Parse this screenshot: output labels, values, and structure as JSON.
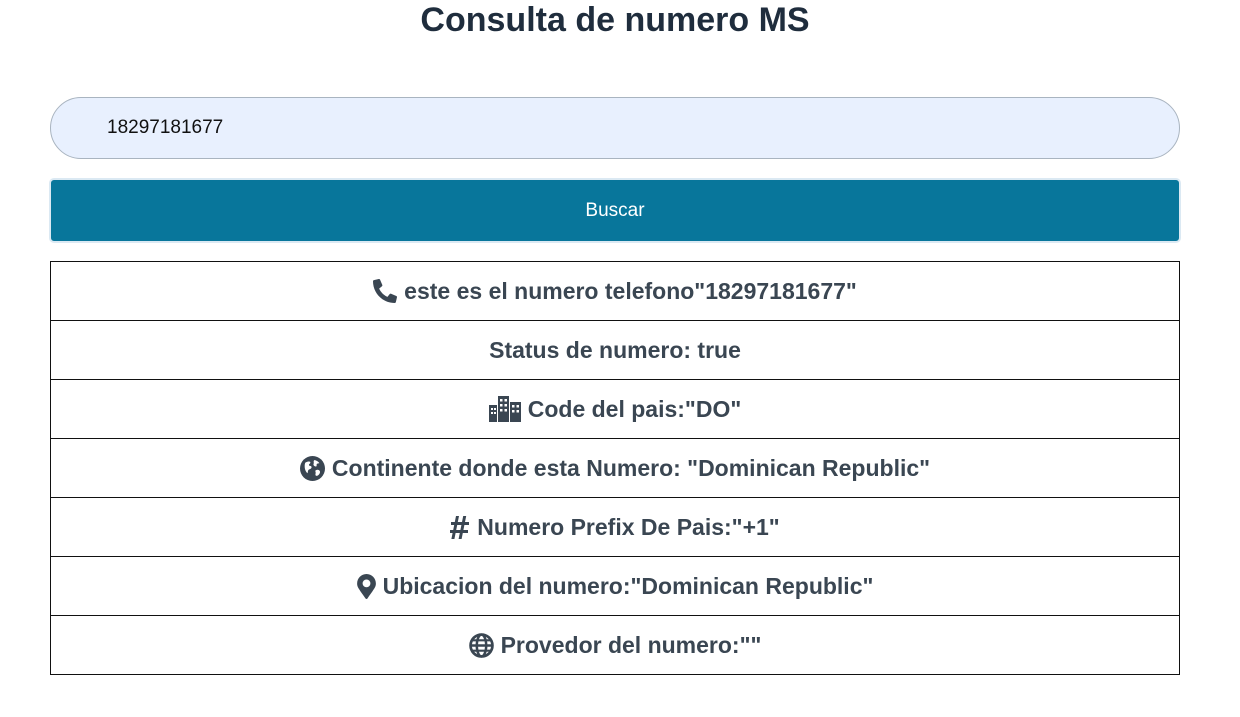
{
  "page": {
    "title": "Consulta de numero MS"
  },
  "search": {
    "value": "18297181677",
    "button_label": "Buscar"
  },
  "results": [
    {
      "icon": "phone-icon",
      "text": "este es el numero telefono\"18297181677\""
    },
    {
      "icon": "",
      "text": "Status de numero: true"
    },
    {
      "icon": "city-icon",
      "text": "Code del pais:\"DO\""
    },
    {
      "icon": "earth-icon",
      "text": "Continente donde esta Numero: \"Dominican Republic\""
    },
    {
      "icon": "hashtag-icon",
      "text": "Numero Prefix De Pais:\"+1\""
    },
    {
      "icon": "location-pin-icon",
      "text": "Ubicacion del numero:\"Dominican Republic\""
    },
    {
      "icon": "globe-icon",
      "text": "Provedor del numero:\"\""
    }
  ],
  "colors": {
    "button_bg": "#08769b",
    "input_bg": "#e8f0fe",
    "text": "#3a4652",
    "title": "#1f2d3d"
  }
}
